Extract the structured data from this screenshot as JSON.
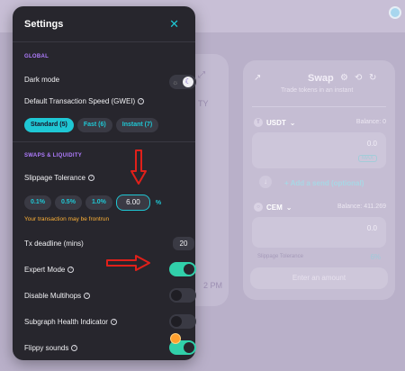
{
  "settings": {
    "title": "Settings",
    "close_icon": "close-icon",
    "global_section": "GLOBAL",
    "dark_mode_label": "Dark mode",
    "speed_label": "Default Transaction Speed (GWEI)",
    "speed_options": [
      "Standard (5)",
      "Fast (6)",
      "Instant (7)"
    ],
    "speed_selected": "Standard (5)",
    "swaps_section": "SWAPS & LIQUIDITY",
    "slippage_label": "Slippage Tolerance",
    "slippage_options": [
      "0.1%",
      "0.5%",
      "1.0%"
    ],
    "slippage_value": "6.00",
    "slippage_unit": "%",
    "frontrun_warning": "Your transaction may be frontrun",
    "tx_deadline_label": "Tx deadline (mins)",
    "tx_deadline_value": "20",
    "expert_mode_label": "Expert Mode",
    "disable_multihops_label": "Disable Multihops",
    "subgraph_label": "Subgraph Health Indicator",
    "flippy_label": "Flippy sounds",
    "toggles": {
      "dark_mode": true,
      "expert_mode": true,
      "disable_multihops": false,
      "subgraph": false,
      "flippy": true
    }
  },
  "swap": {
    "title": "Swap",
    "subtitle": "Trade tokens in an instant",
    "token_from": "USDT",
    "balance_from": "Balance: 0",
    "amount_from": "0.0",
    "max_label": "MAX",
    "add_send": "+ Add a send (optional)",
    "token_to": "CEM",
    "balance_to": "Balance: 411.269",
    "amount_to": "0.0",
    "slippage_label": "Slippage Tolerance",
    "slippage_value": "6%",
    "enter_amount": "Enter an amount"
  },
  "background": {
    "ty_text": "TY",
    "pm_text": "2 PM"
  },
  "colors": {
    "accent": "#1fc7d4",
    "success": "#31d0aa",
    "warning": "#ffb237",
    "section": "#b07cff",
    "annotation": "#e0201a"
  }
}
